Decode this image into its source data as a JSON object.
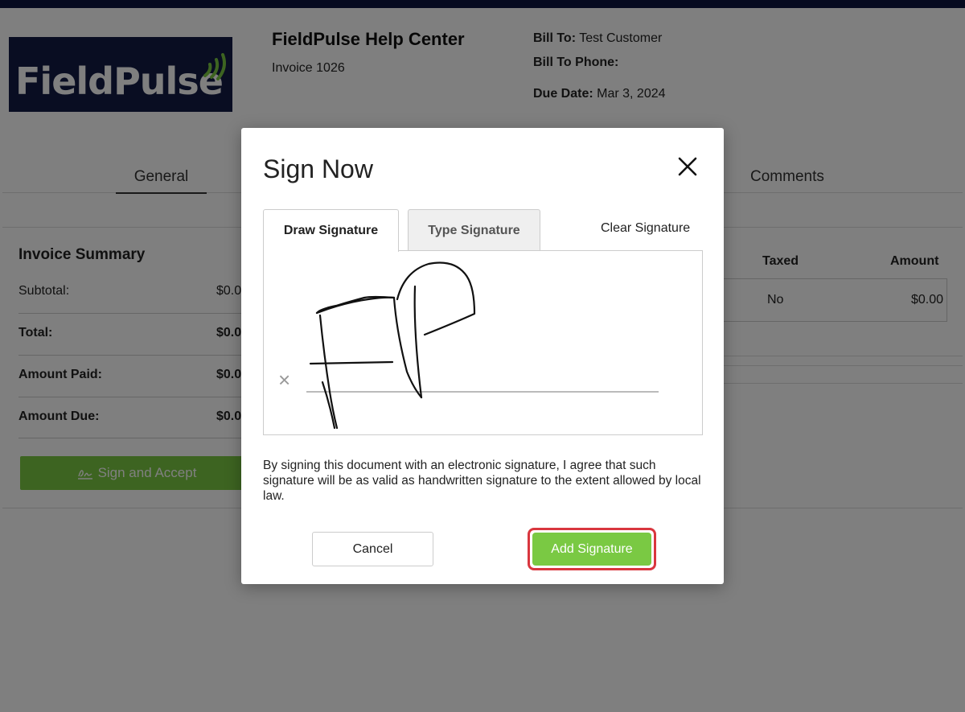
{
  "header": {
    "logo_text": "FieldPulse",
    "company_name": "FieldPulse Help Center",
    "invoice_number": "Invoice 1026",
    "bill_to_label": "Bill To:",
    "bill_to_value": "Test Customer",
    "bill_to_phone_label": "Bill To Phone:",
    "due_date_label": "Due Date:",
    "due_date_value": "Mar 3, 2024"
  },
  "tabs": {
    "general": "General",
    "comments": "Comments"
  },
  "summary": {
    "title": "Invoice Summary",
    "rows": [
      {
        "label": "Subtotal:",
        "value": "$0.0"
      },
      {
        "label": "Total:",
        "value": "$0.0"
      },
      {
        "label": "Amount Paid:",
        "value": "$0.0"
      },
      {
        "label": "Amount Due:",
        "value": "$0.0"
      }
    ],
    "sign_accept_label": "Sign and Accept"
  },
  "items_table": {
    "headers": {
      "taxed": "Taxed",
      "amount": "Amount"
    },
    "rows": [
      {
        "taxed": "No",
        "amount": "$0.00"
      }
    ]
  },
  "modal": {
    "title": "Sign Now",
    "tab_draw": "Draw Signature",
    "tab_type": "Type Signature",
    "clear_label": "Clear Signature",
    "signature_mark": "×",
    "disclaimer": "By signing this document with an electronic signature, I agree that such signature will be as valid as handwritten signature to the extent allowed by local law.",
    "cancel_label": "Cancel",
    "add_label": "Add Signature"
  },
  "colors": {
    "brand_navy": "#121a45",
    "accent_green": "#7ac943",
    "highlight_red": "#d9363e"
  }
}
